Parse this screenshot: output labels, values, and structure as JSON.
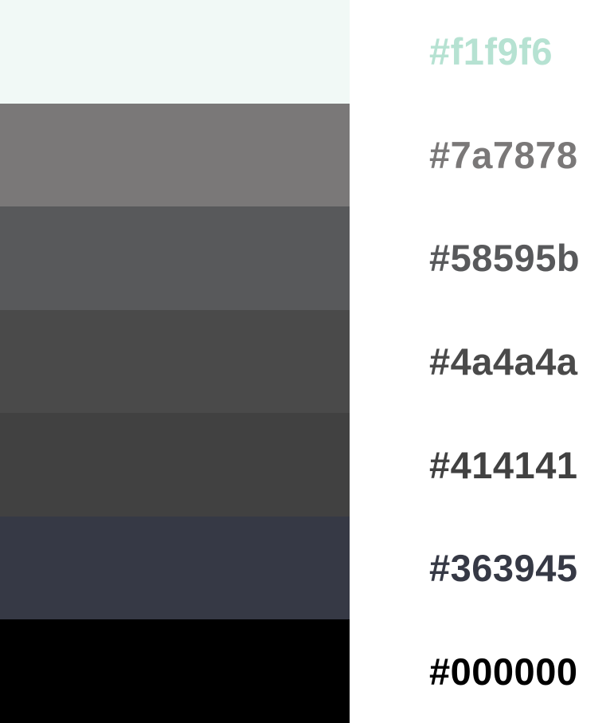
{
  "palette": {
    "swatches": [
      {
        "hex": "#f1f9f6",
        "label_color": "#b6e2d2"
      },
      {
        "hex": "#7a7878",
        "label_color": "#7a7878"
      },
      {
        "hex": "#58595b",
        "label_color": "#58595b"
      },
      {
        "hex": "#4a4a4a",
        "label_color": "#4a4a4a"
      },
      {
        "hex": "#414141",
        "label_color": "#414141"
      },
      {
        "hex": "#363945",
        "label_color": "#363945"
      },
      {
        "hex": "#000000",
        "label_color": "#000000"
      }
    ]
  }
}
